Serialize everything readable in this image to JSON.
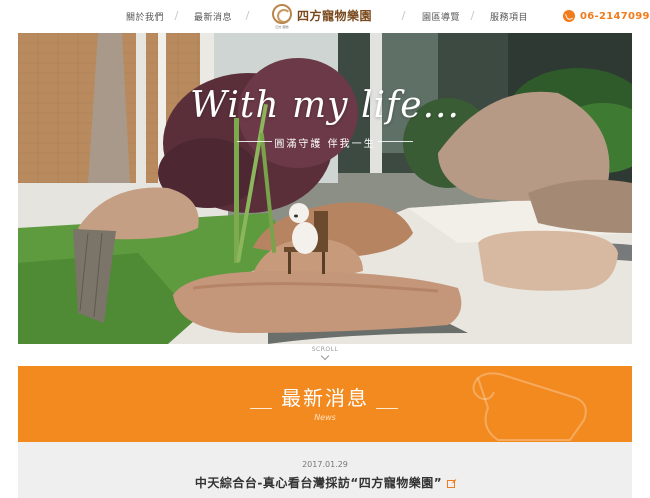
{
  "header": {
    "nav_left": [
      "關於我們",
      "最新消息"
    ],
    "nav_right": [
      "園區導覽",
      "服務項目"
    ],
    "logo_name": "四方寵物樂園",
    "logo_tagline": "四方·寵物",
    "phone": "06-2147099",
    "phone_icon": "phone-icon",
    "accent_color": "#f07c1c"
  },
  "hero": {
    "title": "With my life...",
    "subtitle": "圓滿守護  伴我一生"
  },
  "scroll": {
    "label": "SCROLL"
  },
  "news": {
    "title": "最新消息",
    "subtitle_en": "News",
    "band_color": "#f28a1f",
    "items": [
      {
        "date": "2017.01.29",
        "headline": "中天綜合台-真心看台灣採訪“四方寵物樂園”",
        "icon": "external-link-icon"
      }
    ]
  }
}
